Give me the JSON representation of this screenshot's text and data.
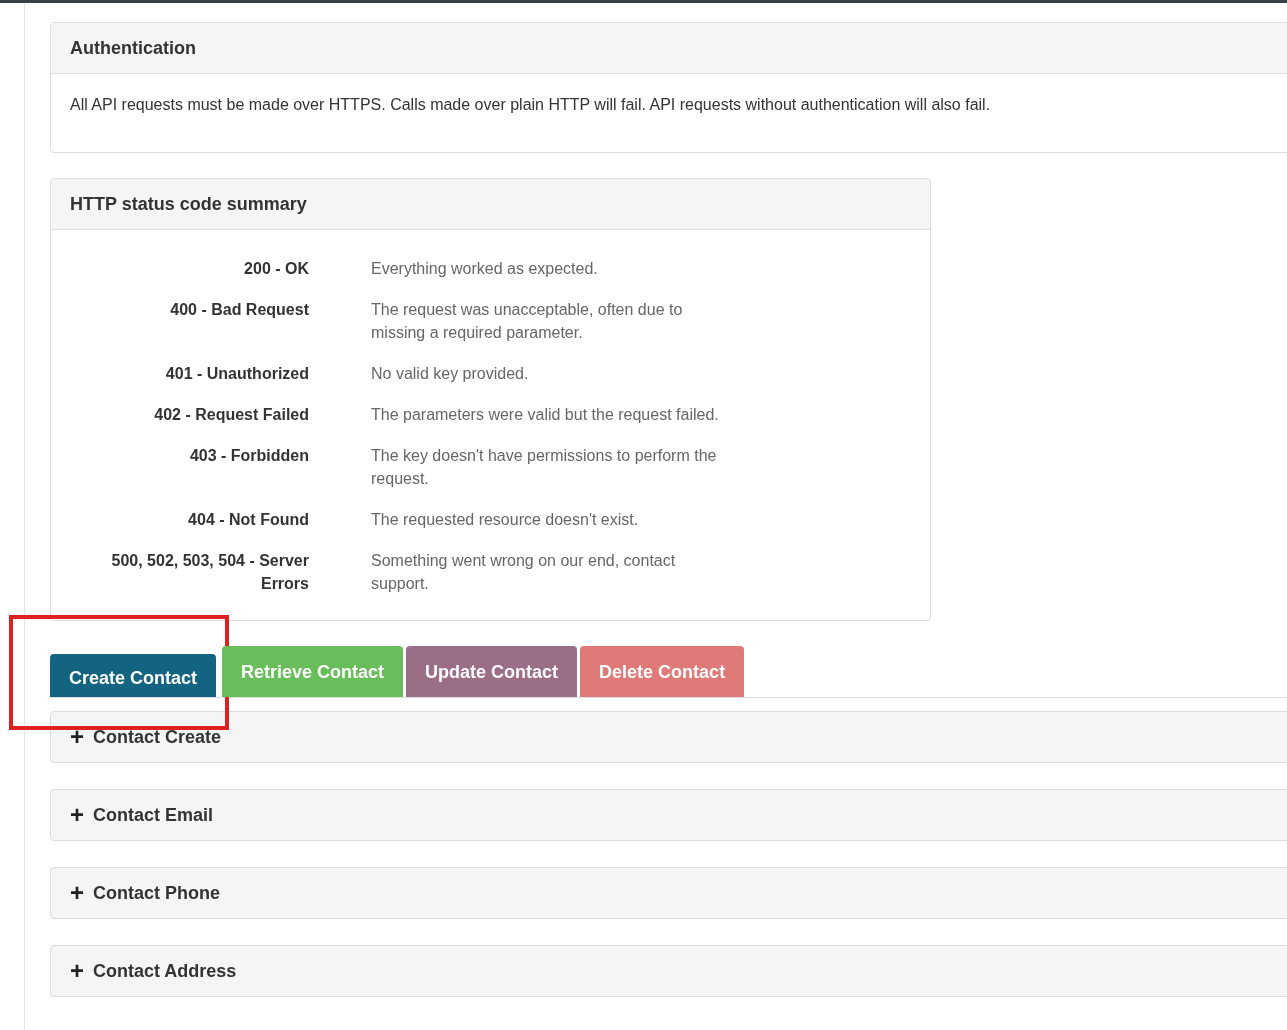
{
  "authentication": {
    "title": "Authentication",
    "text": "All API requests must be made over HTTPS. Calls made over plain HTTP will fail. API requests without authentication will also fail."
  },
  "status_summary": {
    "title": "HTTP status code summary",
    "rows": [
      {
        "code": "200 - OK",
        "description": "Everything worked as expected."
      },
      {
        "code": "400 - Bad Request",
        "description": "The request was unacceptable, often due to missing a required parameter."
      },
      {
        "code": "401 - Unauthorized",
        "description": "No valid key provided."
      },
      {
        "code": "402 - Request Failed",
        "description": "The parameters were valid but the request failed."
      },
      {
        "code": "403 - Forbidden",
        "description": "The key doesn't have permissions to perform the request."
      },
      {
        "code": "404 - Not Found",
        "description": "The requested resource doesn't exist."
      },
      {
        "code": "500, 502, 503, 504 - Server Errors",
        "description": "Something went wrong on our end, contact support."
      }
    ]
  },
  "tabs": [
    {
      "label": "Create Contact",
      "selected": true,
      "highlighted": true,
      "color": "#136480"
    },
    {
      "label": "Retrieve Contact",
      "selected": false,
      "highlighted": false,
      "color": "#6abd5b"
    },
    {
      "label": "Update Contact",
      "selected": false,
      "highlighted": false,
      "color": "#9b6e88"
    },
    {
      "label": "Delete Contact",
      "selected": false,
      "highlighted": false,
      "color": "#e07a79"
    }
  ],
  "sections": [
    {
      "icon": "+",
      "title": "Contact Create"
    },
    {
      "icon": "+",
      "title": "Contact Email"
    },
    {
      "icon": "+",
      "title": "Contact Phone"
    },
    {
      "icon": "+",
      "title": "Contact Address"
    }
  ]
}
